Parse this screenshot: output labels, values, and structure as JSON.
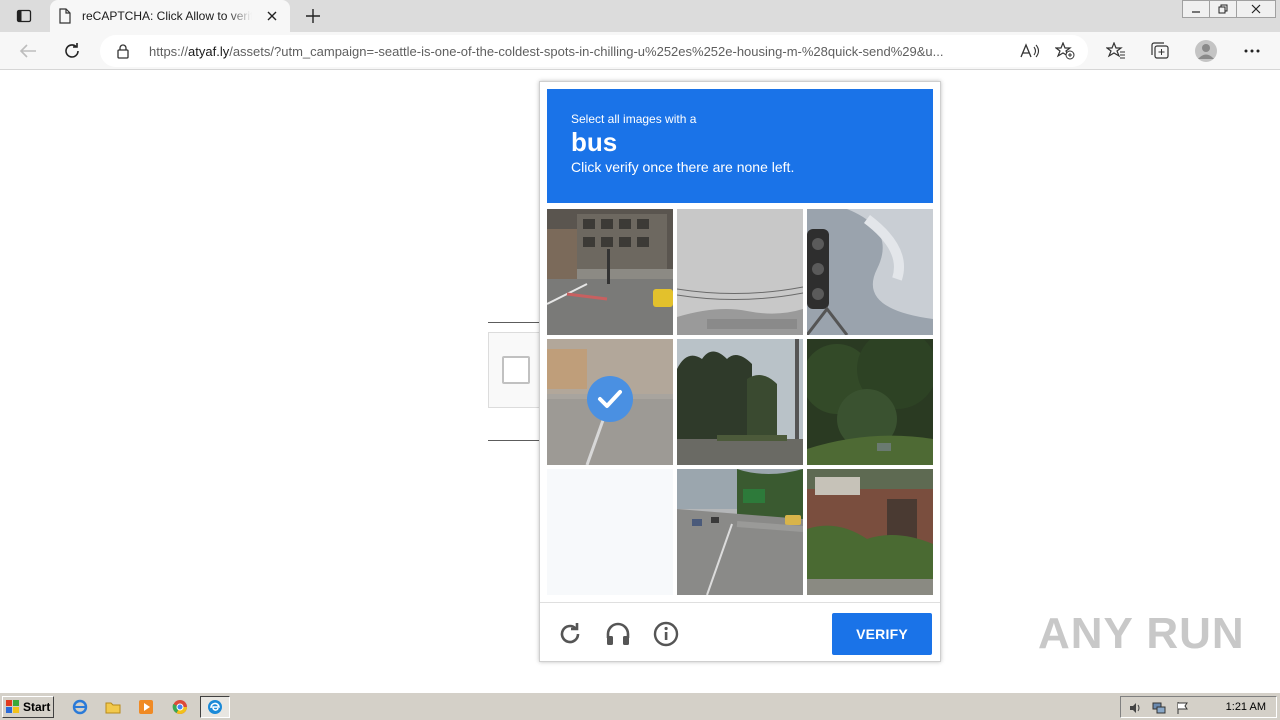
{
  "browser": {
    "tab": {
      "title": "reCAPTCHA: Click Allow to verify"
    },
    "address": {
      "url_prefix": "https://",
      "url_host": "atyaf.ly",
      "url_path": "/assets/?utm_campaign=-seattle-is-one-of-the-coldest-spots-in-chilling-u%252es%252e-housing-m-%28quick-send%29&u..."
    }
  },
  "captcha": {
    "instruction": "Select all images with a",
    "target": "bus",
    "hint": "Click verify once there are none left.",
    "tiles": [
      {
        "scene": "street-building-taxi",
        "selected": false
      },
      {
        "scene": "overcast-sky-wires",
        "selected": false
      },
      {
        "scene": "traffic-light-sky",
        "selected": false
      },
      {
        "scene": "road-faded",
        "selected": true
      },
      {
        "scene": "palm-trees-road",
        "selected": false
      },
      {
        "scene": "green-bushes",
        "selected": false
      },
      {
        "scene": "blank-loading",
        "selected": false
      },
      {
        "scene": "highway-traffic",
        "selected": false
      },
      {
        "scene": "brick-house-garden",
        "selected": false
      }
    ],
    "verify_label": "VERIFY",
    "accent_color": "#1a73e8"
  },
  "watermark": {
    "text": "ANY RUN"
  },
  "taskbar": {
    "start_label": "Start",
    "clock": "1:21 AM"
  }
}
